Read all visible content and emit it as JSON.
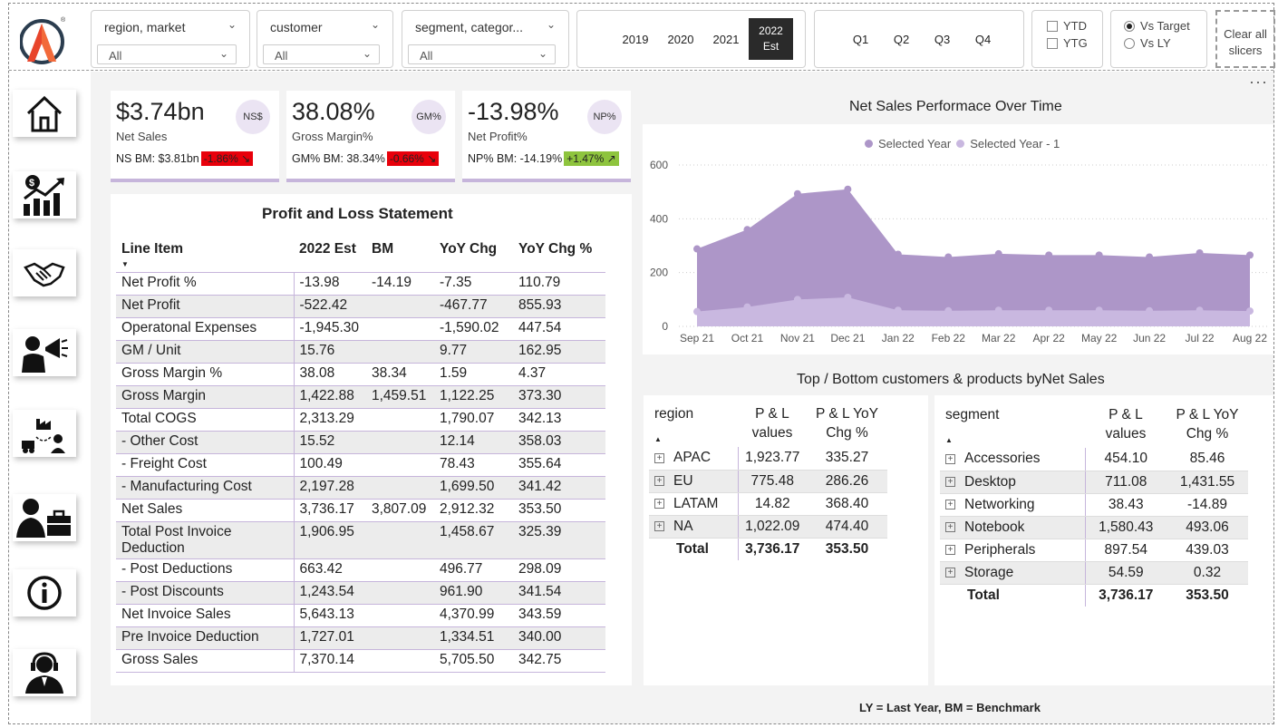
{
  "slicers": {
    "region": {
      "title": "region, market",
      "value": "All"
    },
    "customer": {
      "title": "customer",
      "value": "All"
    },
    "segment": {
      "title": "segment, categor...",
      "value": "All"
    },
    "years": [
      "2019",
      "2020",
      "2021"
    ],
    "selected_year": {
      "line1": "2022",
      "line2": "Est"
    },
    "quarters": [
      "Q1",
      "Q2",
      "Q3",
      "Q4"
    ],
    "ytd": "YTD",
    "ytg": "YTG",
    "vs_target": "Vs Target",
    "vs_ly": "Vs LY",
    "clear_line1": "Clear all",
    "clear_line2": "slicers"
  },
  "kpis": [
    {
      "value": "$3.74bn",
      "label": "Net Sales",
      "badge": "NS$",
      "bm": "NS BM: $3.81bn",
      "chg": "-1.86%",
      "chg_arrow": "↘",
      "chg_color": "#e8000b"
    },
    {
      "value": "38.08%",
      "label": "Gross Margin%",
      "badge": "GM%",
      "bm": "GM% BM: 38.34%",
      "chg": "-0.66%",
      "chg_arrow": "↘",
      "chg_color": "#e8000b"
    },
    {
      "value": "-13.98%",
      "label": "Net Profit%",
      "badge": "NP%",
      "bm": "NP% BM: -14.19%",
      "chg": "+1.47%",
      "chg_arrow": "↗",
      "chg_color": "#8ec43e"
    }
  ],
  "pl": {
    "title": "Profit and Loss Statement",
    "headers": [
      "Line Item",
      "2022 Est",
      "BM",
      "YoY Chg",
      "YoY Chg %"
    ],
    "rows": [
      [
        "Net Profit %",
        "-13.98",
        "-14.19",
        "-7.35",
        "110.79"
      ],
      [
        "Net Profit",
        "-522.42",
        "",
        "-467.77",
        "855.93"
      ],
      [
        "Operatonal Expenses",
        "-1,945.30",
        "",
        "-1,590.02",
        "447.54"
      ],
      [
        "GM / Unit",
        "15.76",
        "",
        "9.77",
        "162.95"
      ],
      [
        "Gross Margin %",
        "38.08",
        "38.34",
        "1.59",
        "4.37"
      ],
      [
        "Gross Margin",
        "1,422.88",
        "1,459.51",
        "1,122.25",
        "373.30"
      ],
      [
        "Total COGS",
        "2,313.29",
        "",
        "1,790.07",
        "342.13"
      ],
      [
        "- Other Cost",
        "15.52",
        "",
        "12.14",
        "358.03"
      ],
      [
        "- Freight Cost",
        "100.49",
        "",
        "78.43",
        "355.64"
      ],
      [
        "- Manufacturing Cost",
        "2,197.28",
        "",
        "1,699.50",
        "341.42"
      ],
      [
        "Net Sales",
        "3,736.17",
        "3,807.09",
        "2,912.32",
        "353.50"
      ],
      [
        "Total Post Invoice Deduction",
        "1,906.95",
        "",
        "1,458.67",
        "325.39"
      ],
      [
        "- Post Deductions",
        "663.42",
        "",
        "496.77",
        "298.09"
      ],
      [
        "- Post Discounts",
        "1,243.54",
        "",
        "961.90",
        "341.54"
      ],
      [
        "Net Invoice Sales",
        "5,643.13",
        "",
        "4,370.99",
        "343.59"
      ],
      [
        "Pre Invoice Deduction",
        "1,727.01",
        "",
        "1,334.51",
        "340.00"
      ],
      [
        "Gross Sales",
        "7,370.14",
        "",
        "5,705.50",
        "342.75"
      ]
    ]
  },
  "chart_data": {
    "type": "area",
    "title": "Net Sales Performace Over Time",
    "categories": [
      "Sep 21",
      "Oct 21",
      "Nov 21",
      "Dec 21",
      "Jan 22",
      "Feb 22",
      "Mar 22",
      "Apr 22",
      "May 22",
      "Jun 22",
      "Jul 22",
      "Aug 22"
    ],
    "series": [
      {
        "name": "Selected Year",
        "color": "#ad96c8",
        "values": [
          288,
          360,
          493,
          510,
          268,
          258,
          270,
          265,
          265,
          258,
          273,
          265
        ]
      },
      {
        "name": "Selected Year - 1",
        "color": "#c9b8e0",
        "values": [
          55,
          72,
          100,
          108,
          60,
          58,
          60,
          60,
          60,
          58,
          60,
          57
        ]
      }
    ],
    "yticks": [
      "0",
      "200",
      "400",
      "600"
    ],
    "ylim": [
      0,
      600
    ],
    "grid": true,
    "legend_position": "top-center"
  },
  "topbottom": {
    "title": "Top / Bottom customers & products byNet Sales",
    "region": {
      "headers": [
        "region",
        "P & L values",
        "P & L YoY Chg %"
      ],
      "rows": [
        [
          "APAC",
          "1,923.77",
          "335.27"
        ],
        [
          "EU",
          "775.48",
          "286.26"
        ],
        [
          "LATAM",
          "14.82",
          "368.40"
        ],
        [
          "NA",
          "1,022.09",
          "474.40"
        ]
      ],
      "total": [
        "Total",
        "3,736.17",
        "353.50"
      ]
    },
    "segment": {
      "headers": [
        "segment",
        "P & L values",
        "P & L YoY Chg %"
      ],
      "rows": [
        [
          "Accessories",
          "454.10",
          "85.46"
        ],
        [
          "Desktop",
          "711.08",
          "1,431.55"
        ],
        [
          "Networking",
          "38.43",
          "-14.89"
        ],
        [
          "Notebook",
          "1,580.43",
          "493.06"
        ],
        [
          "Peripherals",
          "897.54",
          "439.03"
        ],
        [
          "Storage",
          "54.59",
          "0.32"
        ]
      ],
      "total": [
        "Total",
        "3,736.17",
        "353.50"
      ]
    }
  },
  "footer": "LY = Last Year,  BM = Benchmark",
  "icons": [
    "home-icon",
    "finance-chart-icon",
    "handshake-icon",
    "marketing-megaphone-icon",
    "supply-chain-icon",
    "executive-briefcase-icon",
    "info-icon",
    "support-headset-icon"
  ]
}
